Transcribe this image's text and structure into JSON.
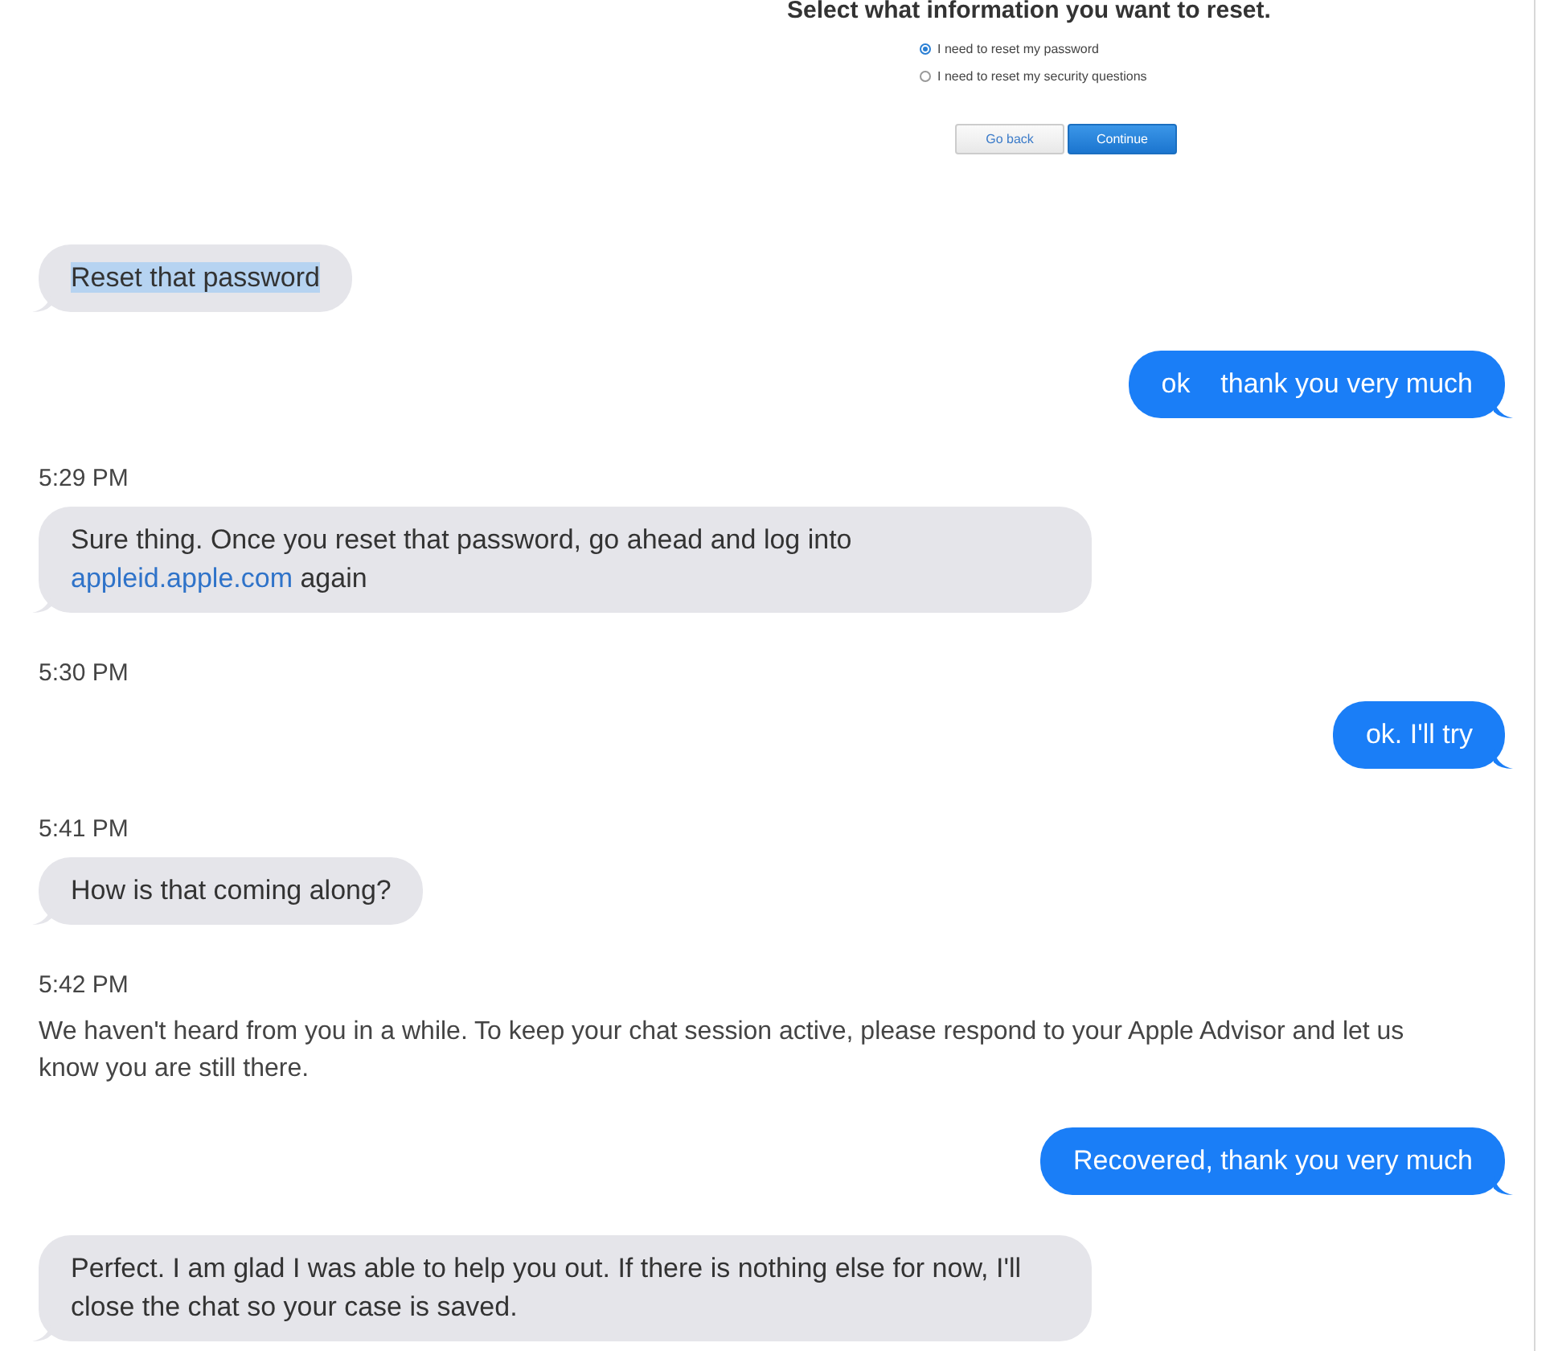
{
  "reset_form": {
    "heading": "Select what information you want to reset.",
    "options": [
      {
        "label": "I need to reset my password",
        "selected": true
      },
      {
        "label": "I need to reset my security questions",
        "selected": false
      }
    ],
    "buttons": [
      {
        "label": "Go back",
        "kind": "secondary"
      },
      {
        "label": "Continue",
        "kind": "primary"
      }
    ]
  },
  "messages": [
    {
      "kind": "incoming",
      "highlighted": true,
      "parts": [
        {
          "text": "Reset that password"
        }
      ]
    },
    {
      "kind": "outgoing",
      "parts": [
        {
          "text": "ok    thank you very much"
        }
      ]
    },
    {
      "kind": "time",
      "text": "5:29 PM"
    },
    {
      "kind": "incoming",
      "highlighted": false,
      "parts": [
        {
          "text": "Sure thing. Once you reset that password, go ahead and log into "
        },
        {
          "text": "appleid.apple.com",
          "link": true
        },
        {
          "text": " again"
        }
      ]
    },
    {
      "kind": "time",
      "text": "5:30 PM"
    },
    {
      "kind": "outgoing",
      "parts": [
        {
          "text": "ok. I'll try"
        }
      ]
    },
    {
      "kind": "time",
      "text": "5:41 PM"
    },
    {
      "kind": "incoming",
      "highlighted": false,
      "parts": [
        {
          "text": "How is that coming along?"
        }
      ]
    },
    {
      "kind": "time",
      "text": "5:42 PM"
    },
    {
      "kind": "notice",
      "text": "We haven't heard from you in a while. To keep your chat session active, please respond to your Apple Advisor and let us know you are still there."
    },
    {
      "kind": "outgoing",
      "parts": [
        {
          "text": "Recovered, thank you very much"
        }
      ]
    },
    {
      "kind": "incoming",
      "highlighted": false,
      "parts": [
        {
          "text": "Perfect. I am glad I was able to help you out. If there is nothing else for now, I'll close the chat so your case is saved."
        }
      ]
    }
  ]
}
